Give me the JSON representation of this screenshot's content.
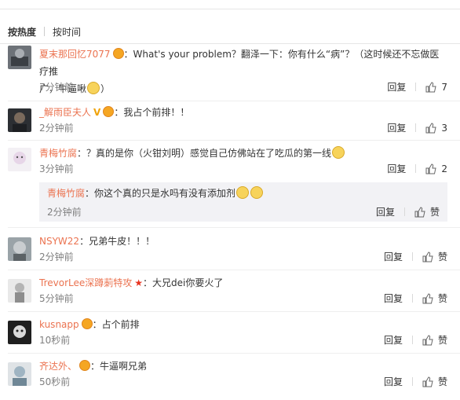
{
  "sort": {
    "hot": "按热度",
    "time": "按时间"
  },
  "reply_label": "回复",
  "like_label": "赞",
  "comments": [
    {
      "name": "夏末那回忆7077",
      "text_a": "：What's your problem？翻泽一下：你有什么“病”？（这时候还不忘做医疗推",
      "text_b": "广，牛逼啾",
      "text_c": "）",
      "time": "7分钟前",
      "likes": "7"
    },
    {
      "name": "_解雨臣夫人",
      "text": "：我占个前排！！",
      "time": "2分钟前",
      "likes": "3"
    },
    {
      "name": "青梅竹腐",
      "text": "：？真的是你（火钳刘明）感觉自己仿佛站在了吃瓜的第一线",
      "time": "3分钟前",
      "likes": "2",
      "sub": {
        "name": "青梅竹腐",
        "text": "：你这个真的只是水吗有没有添加剂",
        "time": "2分钟前"
      }
    },
    {
      "name": "NSYW22",
      "text": "：兄弟牛皮！！！",
      "time": "2分钟前"
    },
    {
      "name": "TrevorLee深蹲莿特攻",
      "text": "：大兄dei你要火了",
      "time": "5分钟前"
    },
    {
      "name": "kusnapp",
      "text": "：占个前排",
      "time": "10秒前"
    },
    {
      "name": "齐达外、",
      "text": "：牛逼啊兄弟",
      "time": "50秒前"
    }
  ],
  "colors": {
    "username": "#eb7350",
    "time": "#808080",
    "subbox_bg": "#f2f2f5"
  },
  "icons": {
    "like": "thumbs-up-icon",
    "vip": "vip-badge-icon",
    "verified": "v-verified-icon",
    "star": "star-icon",
    "emoji": "doge-emoji-icon"
  }
}
